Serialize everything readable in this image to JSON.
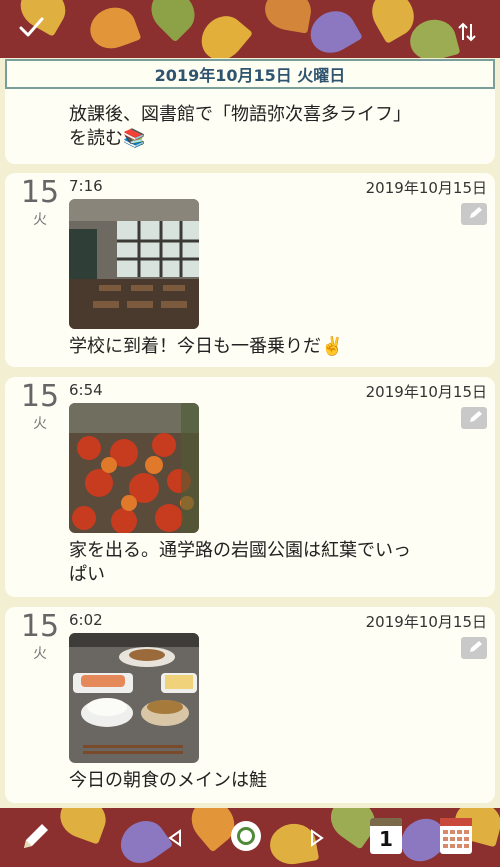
{
  "header": {
    "date_title": "2019年10月15日 火曜日"
  },
  "entries": [
    {
      "text_line1": "放課後、図書館で「物語弥次喜多ライフ」",
      "text_line2": "を読む📚"
    },
    {
      "day": "15",
      "weekday": "火",
      "time": "7:16",
      "date": "2019年10月15日",
      "text": "学校に到着！今日も一番乗りだ✌️",
      "photo": "classroom"
    },
    {
      "day": "15",
      "weekday": "火",
      "time": "6:54",
      "date": "2019年10月15日",
      "text_line1": "家を出る。通学路の岩國公園は紅葉でいっ",
      "text_line2": "ぱい",
      "photo": "autumn leaves"
    },
    {
      "day": "15",
      "weekday": "火",
      "time": "6:02",
      "date": "2019年10月15日",
      "text": "今日の朝食のメインは鮭",
      "photo": "breakfast"
    }
  ],
  "toolbar": {
    "calendar_day": "1"
  },
  "icons": [
    "check-icon",
    "sort-icon",
    "edit-icon",
    "pencil-icon",
    "prev-icon",
    "today-circle-icon",
    "next-icon",
    "day-calendar-icon",
    "month-calendar-icon"
  ],
  "colors": {
    "bar": "#8b2f2f",
    "background": "#f3efd3",
    "card": "#fffef4",
    "banner_text": "#2f5470"
  }
}
